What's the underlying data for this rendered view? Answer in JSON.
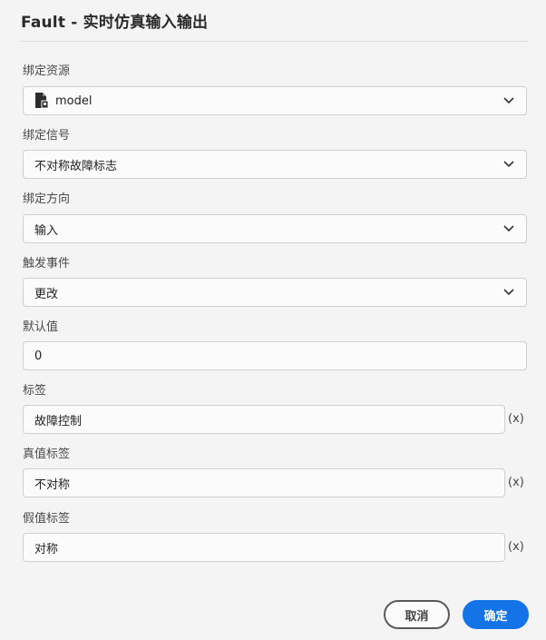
{
  "dialog": {
    "title": "Fault - 实时仿真输入输出"
  },
  "fields": {
    "bind_resource": {
      "label": "绑定资源",
      "value": "model",
      "icon": "model-file-icon"
    },
    "bind_signal": {
      "label": "绑定信号",
      "value": "不对称故障标志"
    },
    "bind_direction": {
      "label": "绑定方向",
      "value": "输入"
    },
    "trigger_event": {
      "label": "触发事件",
      "value": "更改"
    },
    "default_value": {
      "label": "默认值",
      "value": "0"
    },
    "tag": {
      "label": "标签",
      "value": "故障控制",
      "var_button": "(x)"
    },
    "true_tag": {
      "label": "真值标签",
      "value": "不对称",
      "var_button": "(x)"
    },
    "false_tag": {
      "label": "假值标签",
      "value": "对称",
      "var_button": "(x)"
    }
  },
  "actions": {
    "cancel_label": "取消",
    "ok_label": "确定"
  },
  "colors": {
    "primary": "#1473e6",
    "background": "#f4f4f4"
  }
}
